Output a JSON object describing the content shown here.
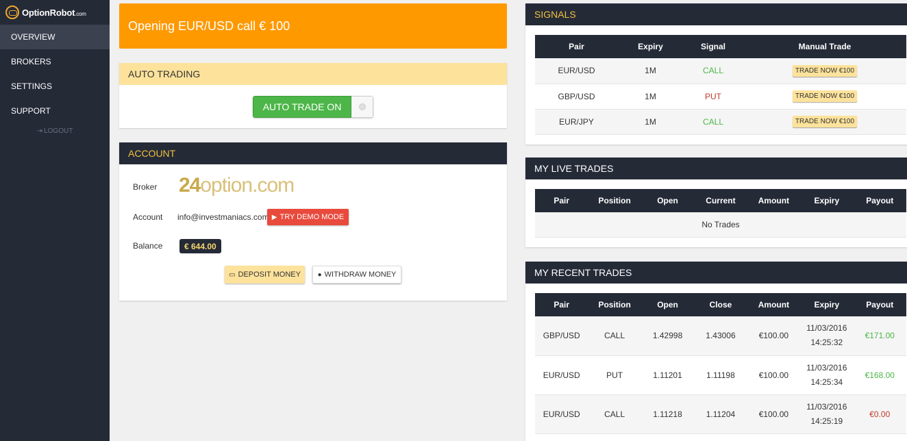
{
  "sidebar": {
    "logo": "OptionRobot",
    "logo_suffix": ".com",
    "items": [
      {
        "label": "OVERVIEW"
      },
      {
        "label": "BROKERS"
      },
      {
        "label": "SETTINGS"
      },
      {
        "label": "SUPPORT"
      }
    ],
    "logout": "LOGOUT"
  },
  "notice": "Opening EUR/USD call € 100",
  "auto_trading": {
    "title": "AUTO TRADING",
    "toggle_label": "AUTO TRADE ON"
  },
  "account": {
    "title": "ACCOUNT",
    "broker_label": "Broker",
    "broker_logo_num": "24",
    "broker_logo_text": "option.com",
    "account_label": "Account",
    "email": "info@investmaniacs.com",
    "demo_button": "TRY DEMO MODE",
    "balance_label": "Balance",
    "balance": "€ 644.00",
    "deposit_button": "DEPOSIT MONEY",
    "withdraw_button": "WITHDRAW MONEY"
  },
  "signals": {
    "title": "SIGNALS",
    "columns": [
      "Pair",
      "Expiry",
      "Signal",
      "Manual Trade"
    ],
    "rows": [
      {
        "pair": "EUR/USD",
        "expiry": "1M",
        "signal": "CALL",
        "action": "TRADE NOW €100"
      },
      {
        "pair": "GBP/USD",
        "expiry": "1M",
        "signal": "PUT",
        "action": "TRADE NOW €100"
      },
      {
        "pair": "EUR/JPY",
        "expiry": "1M",
        "signal": "CALL",
        "action": "TRADE NOW €100"
      }
    ]
  },
  "live_trades": {
    "title": "MY LIVE TRADES",
    "columns": [
      "Pair",
      "Position",
      "Open",
      "Current",
      "Amount",
      "Expiry",
      "Payout"
    ],
    "empty": "No Trades"
  },
  "recent_trades": {
    "title": "MY RECENT TRADES",
    "columns": [
      "Pair",
      "Position",
      "Open",
      "Close",
      "Amount",
      "Expiry",
      "Payout"
    ],
    "rows": [
      {
        "pair": "GBP/USD",
        "position": "CALL",
        "open": "1.42998",
        "close": "1.43006",
        "amount": "€100.00",
        "date": "11/03/2016",
        "time": "14:25:32",
        "payout": "€171.00"
      },
      {
        "pair": "EUR/USD",
        "position": "PUT",
        "open": "1.11201",
        "close": "1.11198",
        "amount": "€100.00",
        "date": "11/03/2016",
        "time": "14:25:34",
        "payout": "€168.00"
      },
      {
        "pair": "EUR/USD",
        "position": "CALL",
        "open": "1.11218",
        "close": "1.11204",
        "amount": "€100.00",
        "date": "11/03/2016",
        "time": "14:25:19",
        "payout": "€0.00"
      }
    ]
  },
  "colors": {
    "sidebar_bg": "#252a37",
    "notice_bg": "#ff9900",
    "toggle_on": "#4cb648",
    "accent_gold": "#fde29b",
    "call": "#4cb648",
    "put": "#c0392b"
  }
}
